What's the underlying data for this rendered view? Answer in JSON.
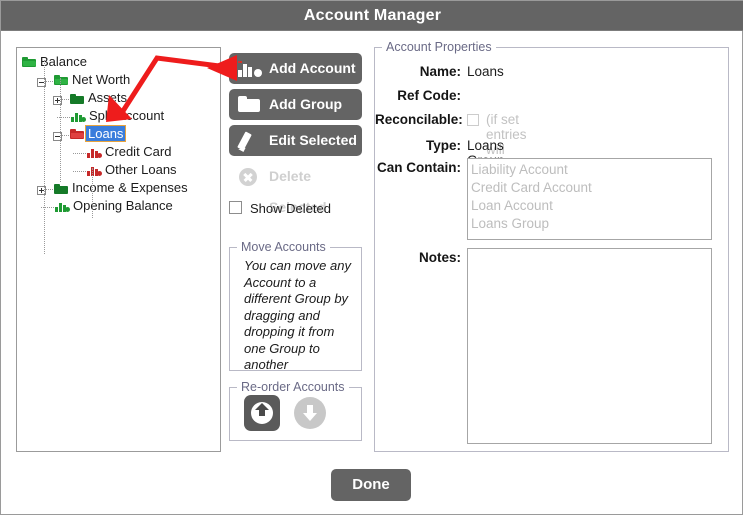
{
  "window": {
    "title": "Account Manager"
  },
  "colors": {
    "titlebar": "#646464",
    "button": "#646464",
    "selection": "#3a7ddc",
    "selection_border": "#e8a33d",
    "asset_green": "#1f9a33",
    "liability_red": "#c62828",
    "annotation_red": "#ee1c1c",
    "legend_text": "#6a6a86",
    "disabled_grey": "#c2c2c2"
  },
  "tree": {
    "name": "account-tree",
    "items": [
      {
        "label": "Balance",
        "icon": "folder-open-green",
        "depth": 0,
        "expander": "none",
        "selected": false
      },
      {
        "label": "Net Worth",
        "icon": "folder-open-green",
        "depth": 1,
        "expander": "minus",
        "selected": false
      },
      {
        "label": "Assets",
        "icon": "folder-closed-green",
        "depth": 2,
        "expander": "plus",
        "selected": false
      },
      {
        "label": "Split Account",
        "icon": "account-green",
        "depth": 2,
        "expander": "none",
        "selected": false
      },
      {
        "label": "Loans",
        "icon": "folder-open-red",
        "depth": 2,
        "expander": "minus",
        "selected": true
      },
      {
        "label": "Credit Card",
        "icon": "account-red",
        "depth": 3,
        "expander": "none",
        "selected": false
      },
      {
        "label": "Other Loans",
        "icon": "account-red",
        "depth": 3,
        "expander": "none",
        "selected": false
      },
      {
        "label": "Income & Expenses",
        "icon": "folder-closed-green",
        "depth": 1,
        "expander": "plus",
        "selected": false
      },
      {
        "label": "Opening Balance",
        "icon": "account-green",
        "depth": 1,
        "expander": "none",
        "selected": false
      }
    ]
  },
  "actions": {
    "add_account": {
      "label": "Add Account",
      "icon": "account-bars-icon",
      "enabled": true
    },
    "add_group": {
      "label": "Add Group",
      "icon": "folder-icon",
      "enabled": true
    },
    "edit": {
      "label": "Edit Selected",
      "icon": "pencil-icon",
      "enabled": true
    },
    "delete": {
      "label": "Delete Selected",
      "icon": "circle-x-icon",
      "enabled": false
    },
    "show_deleted": {
      "label": "Show Deleted",
      "checked": false
    }
  },
  "move_accounts": {
    "legend": "Move Accounts",
    "text": "You can move any Account to a different Group by dragging and dropping it from one Group to another"
  },
  "reorder_accounts": {
    "legend": "Re-order Accounts",
    "up": {
      "icon": "arrow-up-icon",
      "enabled": true
    },
    "down": {
      "icon": "arrow-down-icon",
      "enabled": false
    }
  },
  "properties": {
    "legend": "Account Properties",
    "name": {
      "label": "Name:",
      "value": "Loans"
    },
    "ref_code": {
      "label": "Ref Code:",
      "value": ""
    },
    "reconcilable": {
      "label": "Reconcilable:",
      "checked": false,
      "hint": "(if set entries will not auto clear)"
    },
    "type": {
      "label": "Type:",
      "value": "Loans Group"
    },
    "can_contain": {
      "label": "Can Contain:",
      "options": [
        "Liability Account",
        "Credit Card Account",
        "Loan Account",
        "Loans Group"
      ]
    },
    "notes": {
      "label": "Notes:",
      "value": ""
    }
  },
  "footer": {
    "done_label": "Done"
  }
}
